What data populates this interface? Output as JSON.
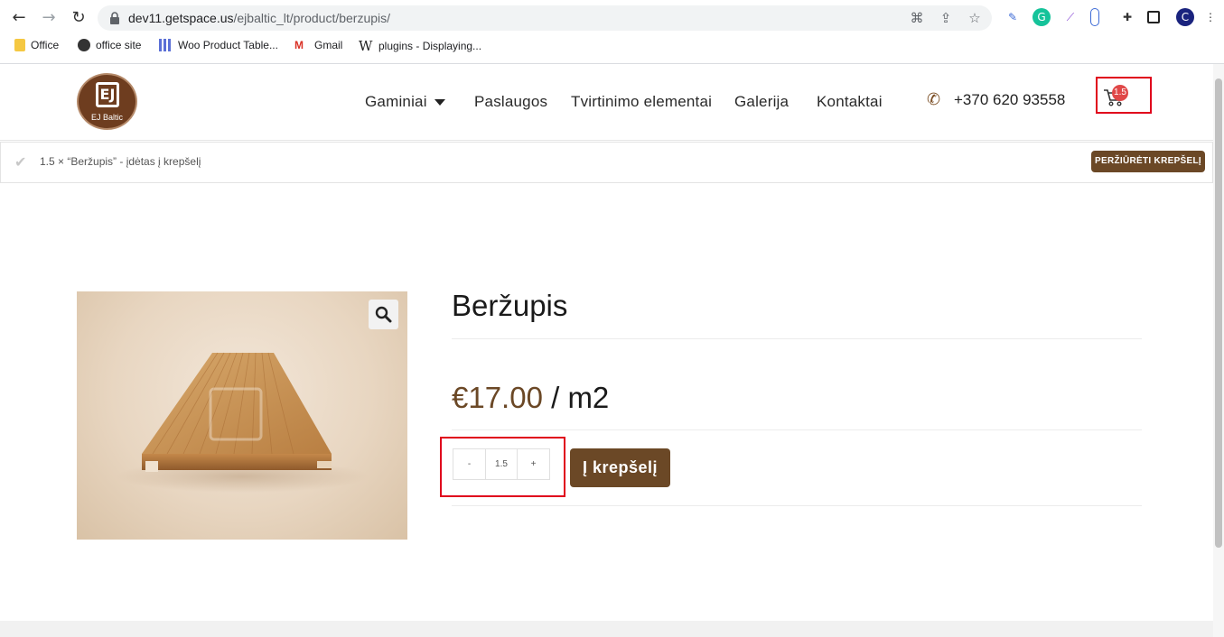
{
  "browser": {
    "url_host": "dev11.getspace.us",
    "url_path": "/ejbaltic_lt/product/berzupis/",
    "bookmarks": [
      {
        "label": "Office",
        "icon": "folder-icon"
      },
      {
        "label": "office site",
        "icon": "globe-icon"
      },
      {
        "label": "Woo Product Table...",
        "icon": "table-icon"
      },
      {
        "label": "Gmail",
        "icon": "gmail-icon"
      },
      {
        "label": "plugins - Displaying...",
        "icon": "wikipedia-icon"
      }
    ]
  },
  "header": {
    "logo_mark": "EJ",
    "logo_text": "EJ Baltic",
    "menu": [
      {
        "label": "Gaminiai",
        "has_dropdown": true
      },
      {
        "label": "Paslaugos"
      },
      {
        "label": "Tvirtinimo elementai"
      },
      {
        "label": "Galerija"
      },
      {
        "label": "Kontaktai"
      }
    ],
    "phone": "+370 620 93558",
    "cart_count": "1.5"
  },
  "notice": {
    "message": "1.5 × “Beržupis” - įdėtas į krepšelį",
    "view_cart_label": "PERŽIŪRĖTI KREPŠELĮ"
  },
  "product": {
    "title": "Beržupis",
    "price": "€17.00",
    "unit": "/ m2",
    "image_watermark": "EJ Baltic",
    "quantity": "1.5",
    "minus_label": "-",
    "plus_label": "+",
    "add_to_cart_label": "Į krepšelį"
  },
  "colors": {
    "brand_brown": "#6b4826",
    "highlight_red": "#e0001b",
    "badge_red": "#e04848"
  }
}
